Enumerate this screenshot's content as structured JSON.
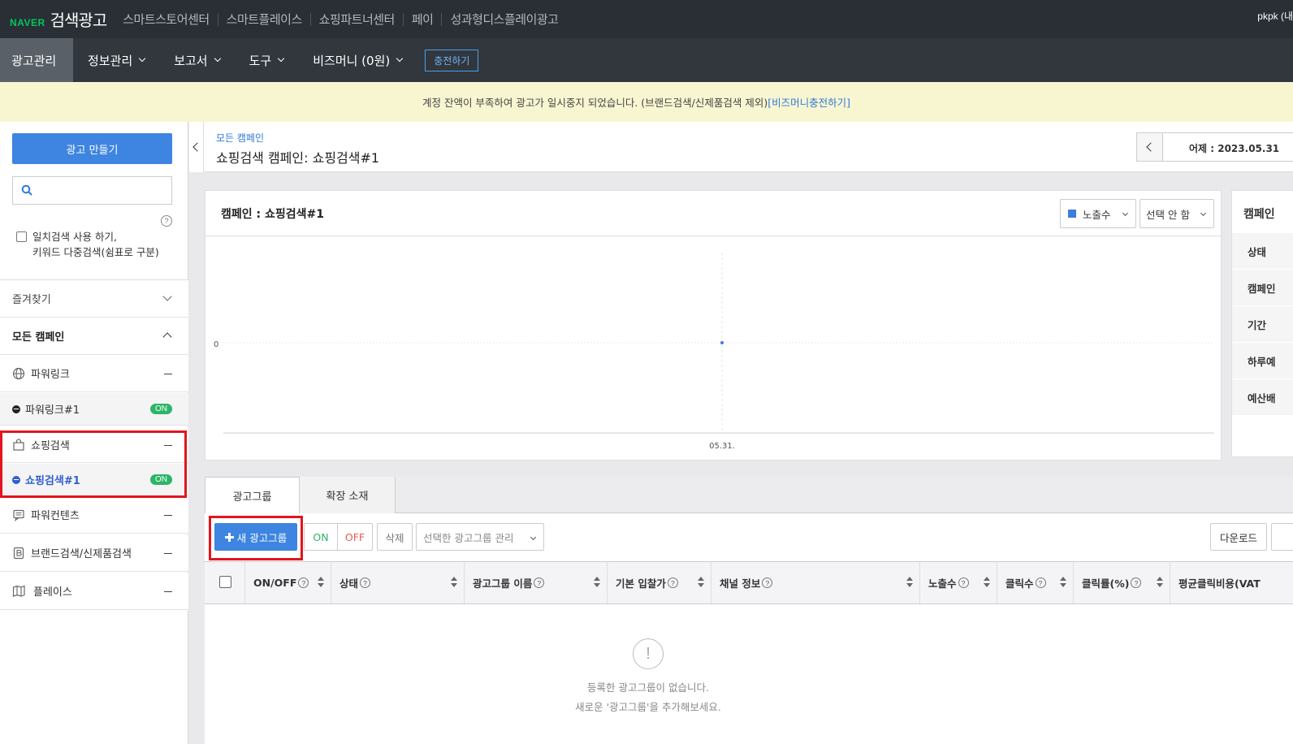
{
  "topbar": {
    "logo_brand": "NAVER",
    "logo_product": "검색광고",
    "service_links": [
      "스마트스토어센터",
      "스마트플레이스",
      "쇼핑파트너센터",
      "페이",
      "성과형디스플레이광고"
    ],
    "user": "pkpk (내"
  },
  "navbar": {
    "items": [
      "광고관리",
      "정보관리",
      "보고서",
      "도구",
      "비즈머니 (0원)"
    ],
    "charge_label": "충전하기"
  },
  "notice": {
    "text": "계정 잔액이 부족하여 광고가 일시중지 되었습니다. (브랜드검색/신제품검색 제외)",
    "link": "[비즈머니충전하기]"
  },
  "sidebar": {
    "create_label": "광고 만들기",
    "search_placeholder": "",
    "exact_search_line1": "일치검색 사용 하기,",
    "exact_search_line2": "키워드 다중검색(쉼표로 구분)",
    "favorites": "즐겨찾기",
    "all_campaigns": "모든 캠페인",
    "groups": {
      "powerlink": "파워링크",
      "powerlink_1": "파워링크#1",
      "shopping": "쇼핑검색",
      "shopping_1": "쇼핑검색#1",
      "powercontents": "파워컨텐츠",
      "brand": "브랜드검색/신제품검색",
      "place": "플레이스"
    },
    "on_badge": "ON"
  },
  "header": {
    "breadcrumb": "모든 캠페인",
    "title": "쇼핑검색 캠페인: 쇼핑검색#1",
    "date_label": "어제 : 2023.05.31"
  },
  "chart_card": {
    "title": "캠페인 : 쇼핑검색#1",
    "metric_select": "노출수",
    "compare_select": "선택 안 함"
  },
  "chart_data": {
    "type": "scatter",
    "x": [
      "05.31."
    ],
    "y": [
      0
    ],
    "y_tick_labels": [
      "0"
    ],
    "series_color": "#3f7be0"
  },
  "info_card": {
    "title": "캠페인",
    "rows": [
      "상태",
      "캠페인",
      "기간",
      "하루예",
      "예산배"
    ]
  },
  "tabs": [
    "광고그룹",
    "확장 소재"
  ],
  "toolbar": {
    "new_group": "새 광고그룹",
    "on": "ON",
    "off": "OFF",
    "delete": "삭제",
    "manage": "선택한 광고그룹 관리",
    "download": "다운로드"
  },
  "table": {
    "columns": [
      "ON/OFF",
      "상태",
      "광고그룹 이름",
      "기본 입찰가",
      "채널 정보",
      "노출수",
      "클릭수",
      "클릭률(%)",
      "평균클릭비용(VAT"
    ]
  },
  "empty": {
    "line1": "등록한 광고그룹이 없습니다.",
    "line2": "새로운 '광고그룹'을 추가해보세요."
  }
}
